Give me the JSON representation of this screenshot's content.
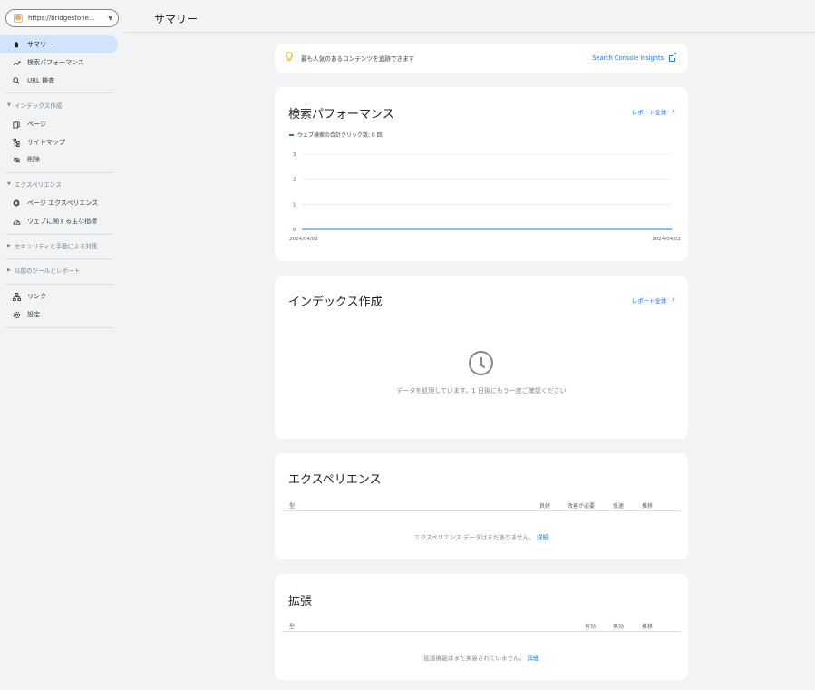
{
  "sidebar": {
    "property": "https://bridgestone...",
    "items": [
      {
        "label": "サマリー",
        "icon": "home-icon"
      },
      {
        "label": "検索パフォーマンス",
        "icon": "trending-up-icon"
      },
      {
        "label": "URL 検査",
        "icon": "search-icon"
      }
    ],
    "section_index": "インデックス作成",
    "index_items": [
      {
        "label": "ページ",
        "icon": "pages-icon"
      },
      {
        "label": "サイトマップ",
        "icon": "sitemap-icon"
      },
      {
        "label": "削除",
        "icon": "eye-off-icon"
      }
    ],
    "section_experience": "エクスペリエンス",
    "experience_items": [
      {
        "label": "ページ エクスペリエンス",
        "icon": "plus-circle-icon"
      },
      {
        "label": "ウェブに関する主な指標",
        "icon": "speed-gauge-icon"
      }
    ],
    "section_security": "セキュリティと手動による対策",
    "section_legacy": "以前のツールとレポート",
    "bottom_items": [
      {
        "label": "リンク",
        "icon": "links-icon"
      },
      {
        "label": "設定",
        "icon": "settings-icon"
      }
    ]
  },
  "header": {
    "title": "サマリー"
  },
  "insights": {
    "text": "最も人気のあるコンテンツを追跡できます",
    "link": "Search Console Insights"
  },
  "performance": {
    "title": "検索パフォーマンス",
    "report_link": "レポート全体",
    "legend": "ウェブ検索の合計クリック数: 0 回"
  },
  "chart_data": {
    "type": "line",
    "x": [
      "2024/04/02",
      "2024/04/02"
    ],
    "series": [
      {
        "values": [
          0,
          0
        ]
      }
    ],
    "y_ticks": [
      "3",
      "2",
      "1",
      "0"
    ],
    "x_tick_labels": [
      "2024/04/02",
      "2024/04/02"
    ],
    "ylim": [
      0,
      3
    ],
    "grid": true,
    "colors": [
      "#1a73e8"
    ]
  },
  "indexing": {
    "title": "インデックス作成",
    "report_link": "レポート全体",
    "message": "データを処理しています。1 日後にもう一度ご確認ください"
  },
  "experience": {
    "title": "エクスペリエンス",
    "columns": [
      "型",
      "良好",
      "改善が必要",
      "低速",
      "推移"
    ],
    "empty": "エクスペリエンス データはまだありません。",
    "link": "詳細"
  },
  "enhancements": {
    "title": "拡張",
    "columns": [
      "型",
      "有効",
      "無効",
      "推移"
    ],
    "empty": "拡張機能はまだ実装されていません。",
    "link": "詳細"
  }
}
